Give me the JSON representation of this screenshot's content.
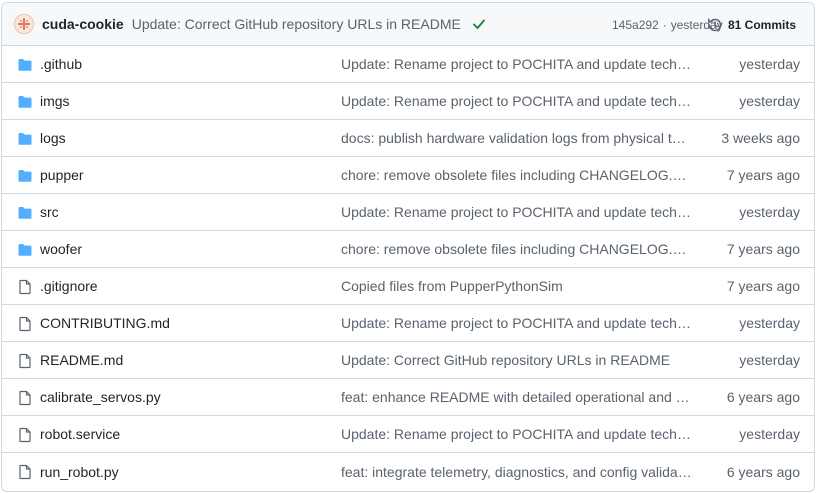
{
  "colors": {
    "folder": "#54aeff",
    "file": "#59636e",
    "success": "#1a7f37",
    "border": "#d1d9e0"
  },
  "latest_commit": {
    "author": "cuda-cookie",
    "avatar_icon": "avatar-icon",
    "message": "Update: Correct GitHub repository URLs in README",
    "status_icon": "check-icon",
    "hash": "145a292",
    "separator": "·",
    "time": "yesterday",
    "history_icon": "history-icon",
    "commits_label": "81 Commits"
  },
  "files": [
    {
      "type": "dir",
      "icon": "folder-icon",
      "name": ".github",
      "message": "Update: Rename project to POCHITA and update technical documentation",
      "age": "yesterday"
    },
    {
      "type": "dir",
      "icon": "folder-icon",
      "name": "imgs",
      "message": "Update: Rename project to POCHITA and update technical documentation",
      "age": "yesterday"
    },
    {
      "type": "dir",
      "icon": "folder-icon",
      "name": "logs",
      "message": "docs: publish hardware validation logs from physical test runs",
      "age": "3 weeks ago"
    },
    {
      "type": "dir",
      "icon": "folder-icon",
      "name": "pupper",
      "message": "chore: remove obsolete files including CHANGELOG.md, LICENSE",
      "age": "7 years ago"
    },
    {
      "type": "dir",
      "icon": "folder-icon",
      "name": "src",
      "message": "Update: Rename project to POCHITA and update technical documentation",
      "age": "yesterday"
    },
    {
      "type": "dir",
      "icon": "folder-icon",
      "name": "woofer",
      "message": "chore: remove obsolete files including CHANGELOG.md, LICENSE",
      "age": "7 years ago"
    },
    {
      "type": "file",
      "icon": "file-icon",
      "name": ".gitignore",
      "message": "Copied files from PupperPythonSim",
      "age": "7 years ago"
    },
    {
      "type": "file",
      "icon": "file-icon",
      "name": "CONTRIBUTING.md",
      "message": "Update: Rename project to POCHITA and update technical documentation",
      "age": "yesterday"
    },
    {
      "type": "file",
      "icon": "file-icon",
      "name": "README.md",
      "message": "Update: Correct GitHub repository URLs in README",
      "age": "yesterday"
    },
    {
      "type": "file",
      "icon": "file-icon",
      "name": "calibrate_servos.py",
      "message": "feat: enhance README with detailed operational and engineering notes",
      "age": "6 years ago"
    },
    {
      "type": "file",
      "icon": "file-icon",
      "name": "robot.service",
      "message": "Update: Rename project to POCHITA and update technical documentation",
      "age": "yesterday"
    },
    {
      "type": "file",
      "icon": "file-icon",
      "name": "run_robot.py",
      "message": "feat: integrate telemetry, diagnostics, and config validation in run_robot",
      "age": "6 years ago"
    }
  ]
}
